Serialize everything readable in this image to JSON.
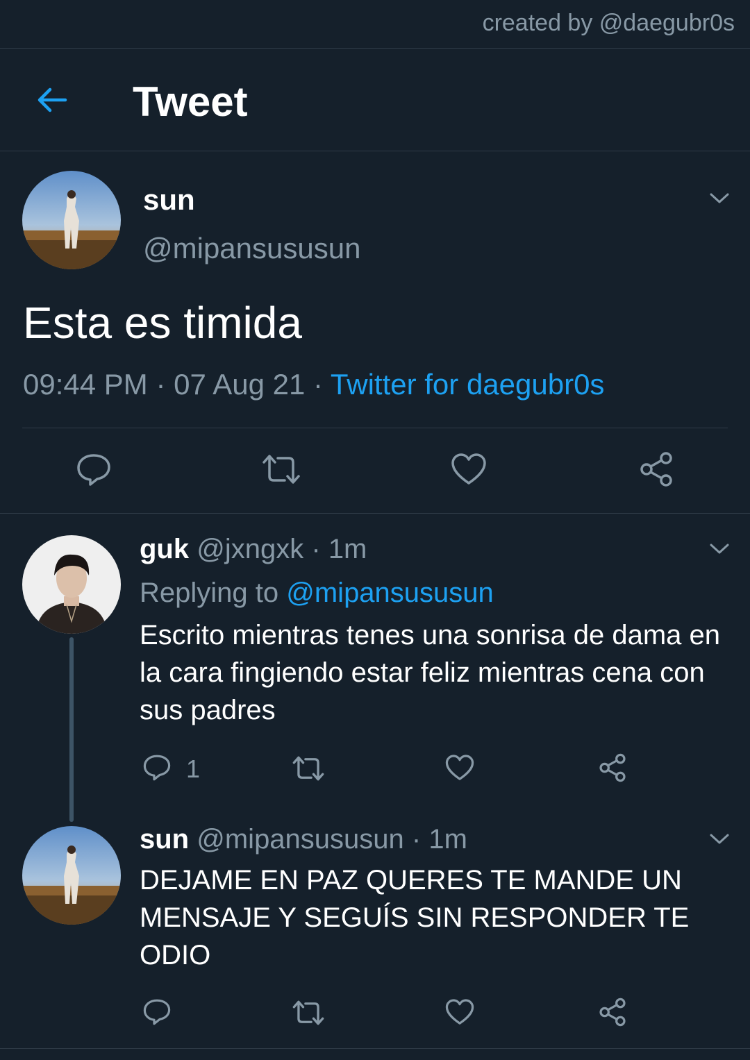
{
  "credit": "created by @daegubr0s",
  "header": {
    "title": "Tweet"
  },
  "main_tweet": {
    "name": "sun",
    "handle": "@mipansususun",
    "text": "Esta es timida",
    "time": "09:44 PM",
    "date": "07 Aug 21",
    "client": "Twitter for daegubr0s"
  },
  "replies": [
    {
      "name": "guk",
      "handle": "@jxngxk",
      "age": "1m",
      "replying_prefix": "Replying to",
      "replying_to": "@mipansususun",
      "text": "Escrito mientras tenes una sonrisa de dama en la cara fingiendo estar feliz mientras cena con sus padres",
      "reply_count": "1"
    },
    {
      "name": "sun",
      "handle": "@mipansususun",
      "age": "1m",
      "text": "DEJAME EN PAZ QUERES TE MANDE UN MENSAJE Y SEGUÍS SIN RESPONDER TE ODIO"
    }
  ],
  "colors": {
    "background": "#15202b",
    "accent": "#1da1f2",
    "muted": "#8899a6",
    "divider": "#2f3b47"
  }
}
